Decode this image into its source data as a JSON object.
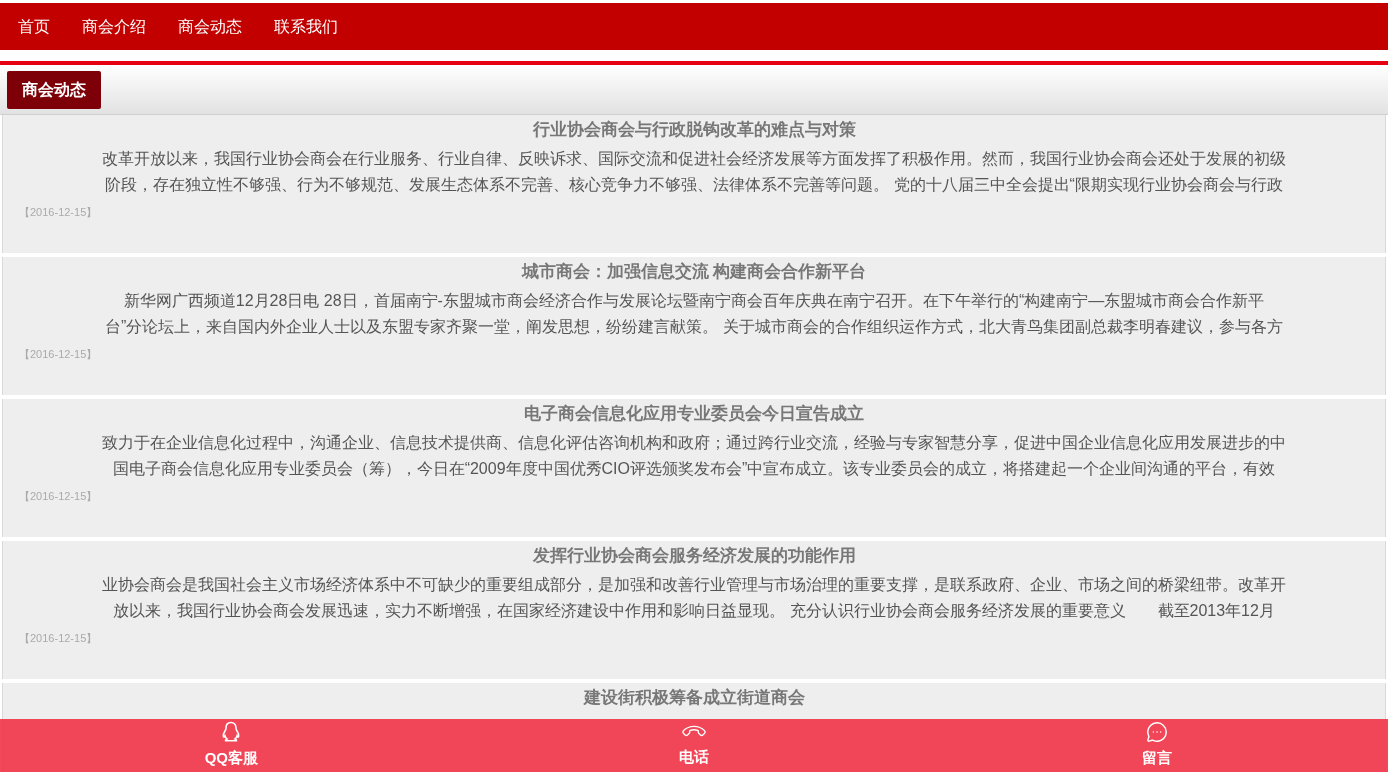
{
  "nav": {
    "items": [
      {
        "label": "首页"
      },
      {
        "label": "商会介绍"
      },
      {
        "label": "商会动态"
      },
      {
        "label": "联系我们"
      }
    ]
  },
  "section": {
    "title": "商会动态"
  },
  "articles": [
    {
      "title": "行业协会商会与行政脱钩改革的难点与对策",
      "lines": [
        "改革开放以来，我国行业协会商会在行业服务、行业自律、反映诉求、国际交流和促进社会经济发展等方面发挥了积极作用。然而，我国行业协会商会还处于发展的初级",
        "阶段，存在独立性不够强、行为不够规范、发展生态体系不完善、核心竞争力不够强、法律体系不完善等问题。 党的十八届三中全会提出“限期实现行业协会商会与行政"
      ],
      "date": "【2016-12-15】"
    },
    {
      "title": "城市商会：加强信息交流 构建商会合作新平台",
      "lines": [
        "新华网广西频道12月28日电 28日，首届南宁-东盟城市商会经济合作与发展论坛暨南宁商会百年庆典在南宁召开。在下午举行的“构建南宁—东盟城市商会合作新平",
        "台”分论坛上，来自国内外企业人士以及东盟专家齐聚一堂，阐发思想，纷纷建言献策。 关于城市商会的合作组织运作方式，北大青鸟集团副总裁李明春建议，参与各方"
      ],
      "date": "【2016-12-15】"
    },
    {
      "title": "电子商会信息化应用专业委员会今日宣告成立",
      "lines": [
        "致力于在企业信息化过程中，沟通企业、信息技术提供商、信息化评估咨询机构和政府；通过跨行业交流，经验与专家智慧分享，促进中国企业信息化应用发展进步的中",
        "国电子商会信息化应用专业委员会（筹），今日在“2009年度中国优秀CIO评选颁奖发布会”中宣布成立。该专业委员会的成立，将搭建起一个企业间沟通的平台，有效"
      ],
      "date": "【2016-12-15】"
    },
    {
      "title": "发挥行业协会商会服务经济发展的功能作用",
      "lines": [
        "业协会商会是我国社会主义市场经济体系中不可缺少的重要组成部分，是加强和改善行业管理与市场治理的重要支撑，是联系政府、企业、市场之间的桥梁纽带。改革开",
        "放以来，我国行业协会商会发展迅速，实力不断增强，在国家经济建设中作用和影响日益显现。 充分认识行业协会商会服务经济发展的重要意义　　截至2013年12月"
      ],
      "date": "【2016-12-15】"
    },
    {
      "title": "建设街积极筹备成立街道商会"
    }
  ],
  "bottom_bar": {
    "items": [
      {
        "kind": "qq",
        "label": "QQ客服"
      },
      {
        "kind": "phone",
        "label": "电话"
      },
      {
        "kind": "message",
        "label": "留言"
      }
    ]
  }
}
